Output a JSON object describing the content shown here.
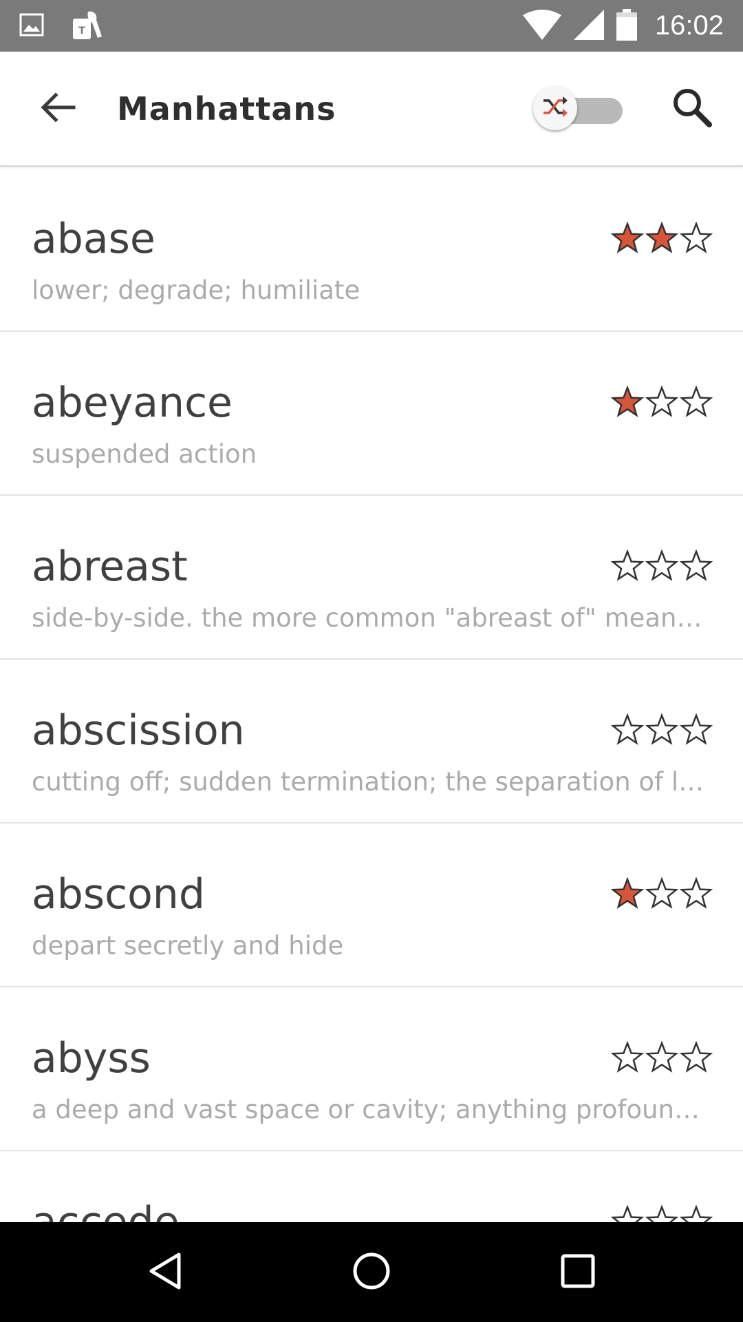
{
  "status_bar": {
    "time": "16:02",
    "icons": [
      "image-icon",
      "tmobile-icon",
      "wifi-icon",
      "signal-icon",
      "battery-icon"
    ]
  },
  "app_bar": {
    "title": "Manhattans",
    "shuffle_enabled": false,
    "back_icon": "arrow-back-icon",
    "search_icon": "search-icon"
  },
  "colors": {
    "star_filled": "#d9553a",
    "star_outline": "#333333",
    "status_bar_bg": "#7a7a7a"
  },
  "words": [
    {
      "term": "abase",
      "definition": "lower; degrade; humiliate",
      "rating": 2,
      "max_rating": 3
    },
    {
      "term": "abeyance",
      "definition": "suspended action",
      "rating": 1,
      "max_rating": 3
    },
    {
      "term": "abreast",
      "definition": "side-by-side. the more common \"abreast of\" means…",
      "rating": 0,
      "max_rating": 3
    },
    {
      "term": "abscission",
      "definition": "cutting off; sudden termination; the separation of le…",
      "rating": 0,
      "max_rating": 3
    },
    {
      "term": "abscond",
      "definition": "depart secretly and hide",
      "rating": 1,
      "max_rating": 3
    },
    {
      "term": "abyss",
      "definition": "a deep and vast space or cavity; anything profound…",
      "rating": 0,
      "max_rating": 3
    },
    {
      "term": "accede",
      "definition": "",
      "rating": 0,
      "max_rating": 3
    }
  ],
  "nav_bar": {
    "buttons": [
      "back-triangle-icon",
      "home-circle-icon",
      "recents-square-icon"
    ]
  }
}
